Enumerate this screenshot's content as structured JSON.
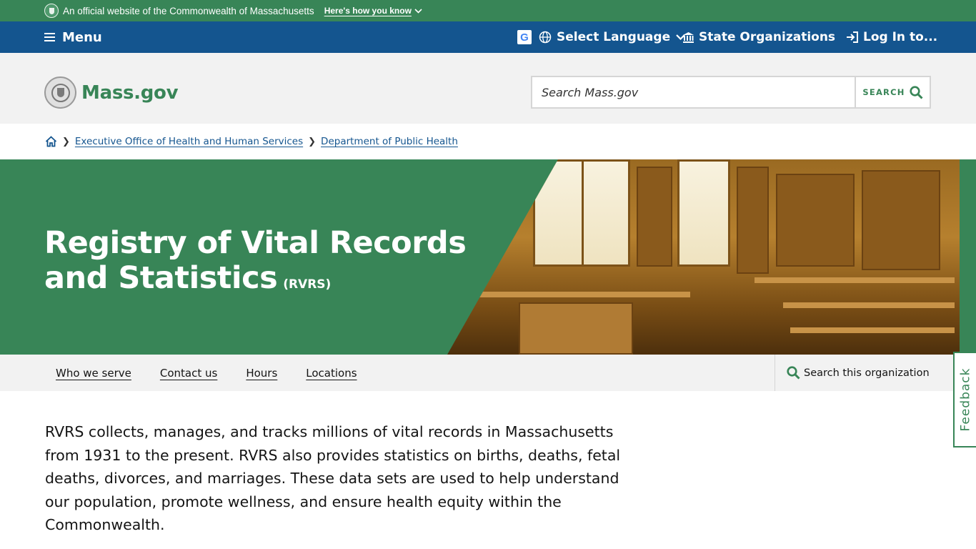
{
  "official_banner": {
    "text": "An official website of the Commonwealth of Massachusetts",
    "how_link": "Here's how you know"
  },
  "utility_nav": {
    "menu_label": "Menu",
    "google_letter": "G",
    "language_label": "Select Language",
    "orgs_label": "State Organizations",
    "login_label": "Log In to..."
  },
  "header": {
    "logo_text": "Mass.gov",
    "search_placeholder": "Search Mass.gov",
    "search_button": "SEARCH"
  },
  "breadcrumb": {
    "items": [
      "Executive Office of Health and Human Services",
      "Department of Public Health"
    ]
  },
  "hero": {
    "title": "Registry of Vital Records and Statistics",
    "acronym": "(RVRS)"
  },
  "subnav": {
    "links": [
      "Who we serve",
      "Contact us",
      "Hours",
      "Locations"
    ],
    "org_search": "Search this organization"
  },
  "feedback_label": "Feedback",
  "intro_text": "RVRS collects, manages, and tracks millions of vital records in Massachusetts from 1931 to the present. RVRS also provides statistics on births, deaths, fetal deaths, divorces, and marriages. These data sets are used to help understand our population, promote wellness, and ensure health equity within the Commonwealth.",
  "colors": {
    "brand_green": "#388557",
    "brand_blue": "#14558f",
    "header_gray": "#f2f2f2"
  }
}
